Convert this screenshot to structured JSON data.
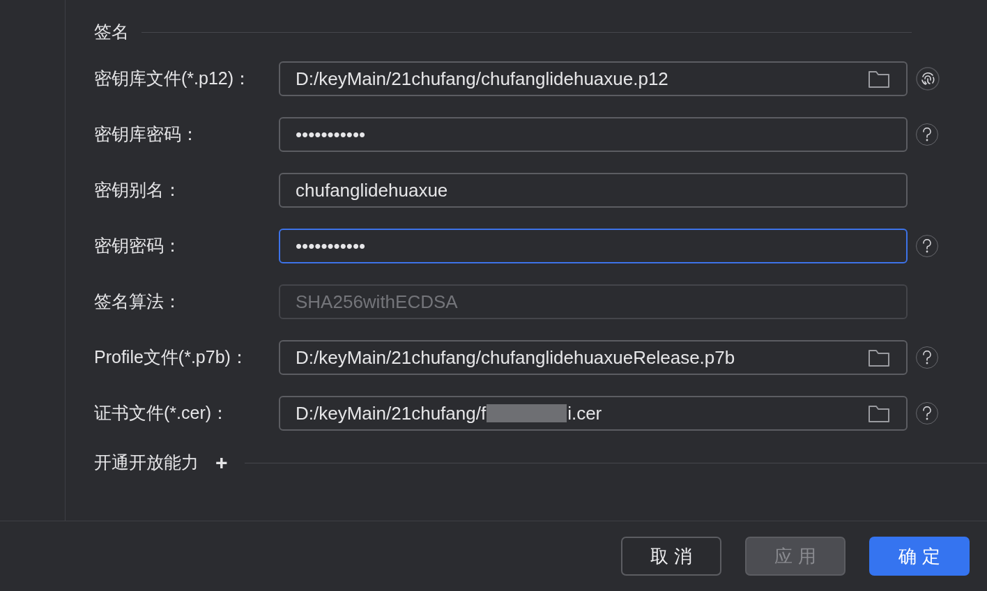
{
  "section_title": "签名",
  "fields": [
    {
      "label": "密钥库文件(*.p12)：",
      "kind": "file",
      "value": "D:/keyMain/21chufang/chufanglidehuaxue.p12",
      "focused": false,
      "side_icon": {
        "kind": "fingerprint"
      }
    },
    {
      "label": "密钥库密码：",
      "kind": "password",
      "value": "•••••••••••",
      "focused": false,
      "side_icon": {
        "kind": "help"
      }
    },
    {
      "label": "密钥别名：",
      "kind": "text",
      "value": "chufanglidehuaxue",
      "focused": false
    },
    {
      "label": "密钥密码：",
      "kind": "password",
      "value": "•••••••••••",
      "focused": true,
      "side_icon": {
        "kind": "help"
      }
    },
    {
      "label": "签名算法：",
      "kind": "disabled",
      "value": "SHA256withECDSA",
      "focused": false
    },
    {
      "label": "Profile文件(*.p7b)：",
      "kind": "file",
      "value": "D:/keyMain/21chufang/chufanglidehuaxueRelease.p7b",
      "focused": false,
      "side_icon": {
        "kind": "help"
      }
    },
    {
      "label": "证书文件(*.cer)：",
      "kind": "redacted-file",
      "value": "D:/keyMain/21chufang/f",
      "value_end": "i.cer",
      "focused": false,
      "side_icon": {
        "kind": "help"
      }
    }
  ],
  "open_capabilities": {
    "title": "开通开放能力",
    "icon": "+"
  },
  "buttons": [
    {
      "label": "取 消",
      "kind": "secondary"
    },
    {
      "label": "应 用",
      "kind": "disabled"
    },
    {
      "label": "确 定",
      "kind": "primary"
    }
  ]
}
